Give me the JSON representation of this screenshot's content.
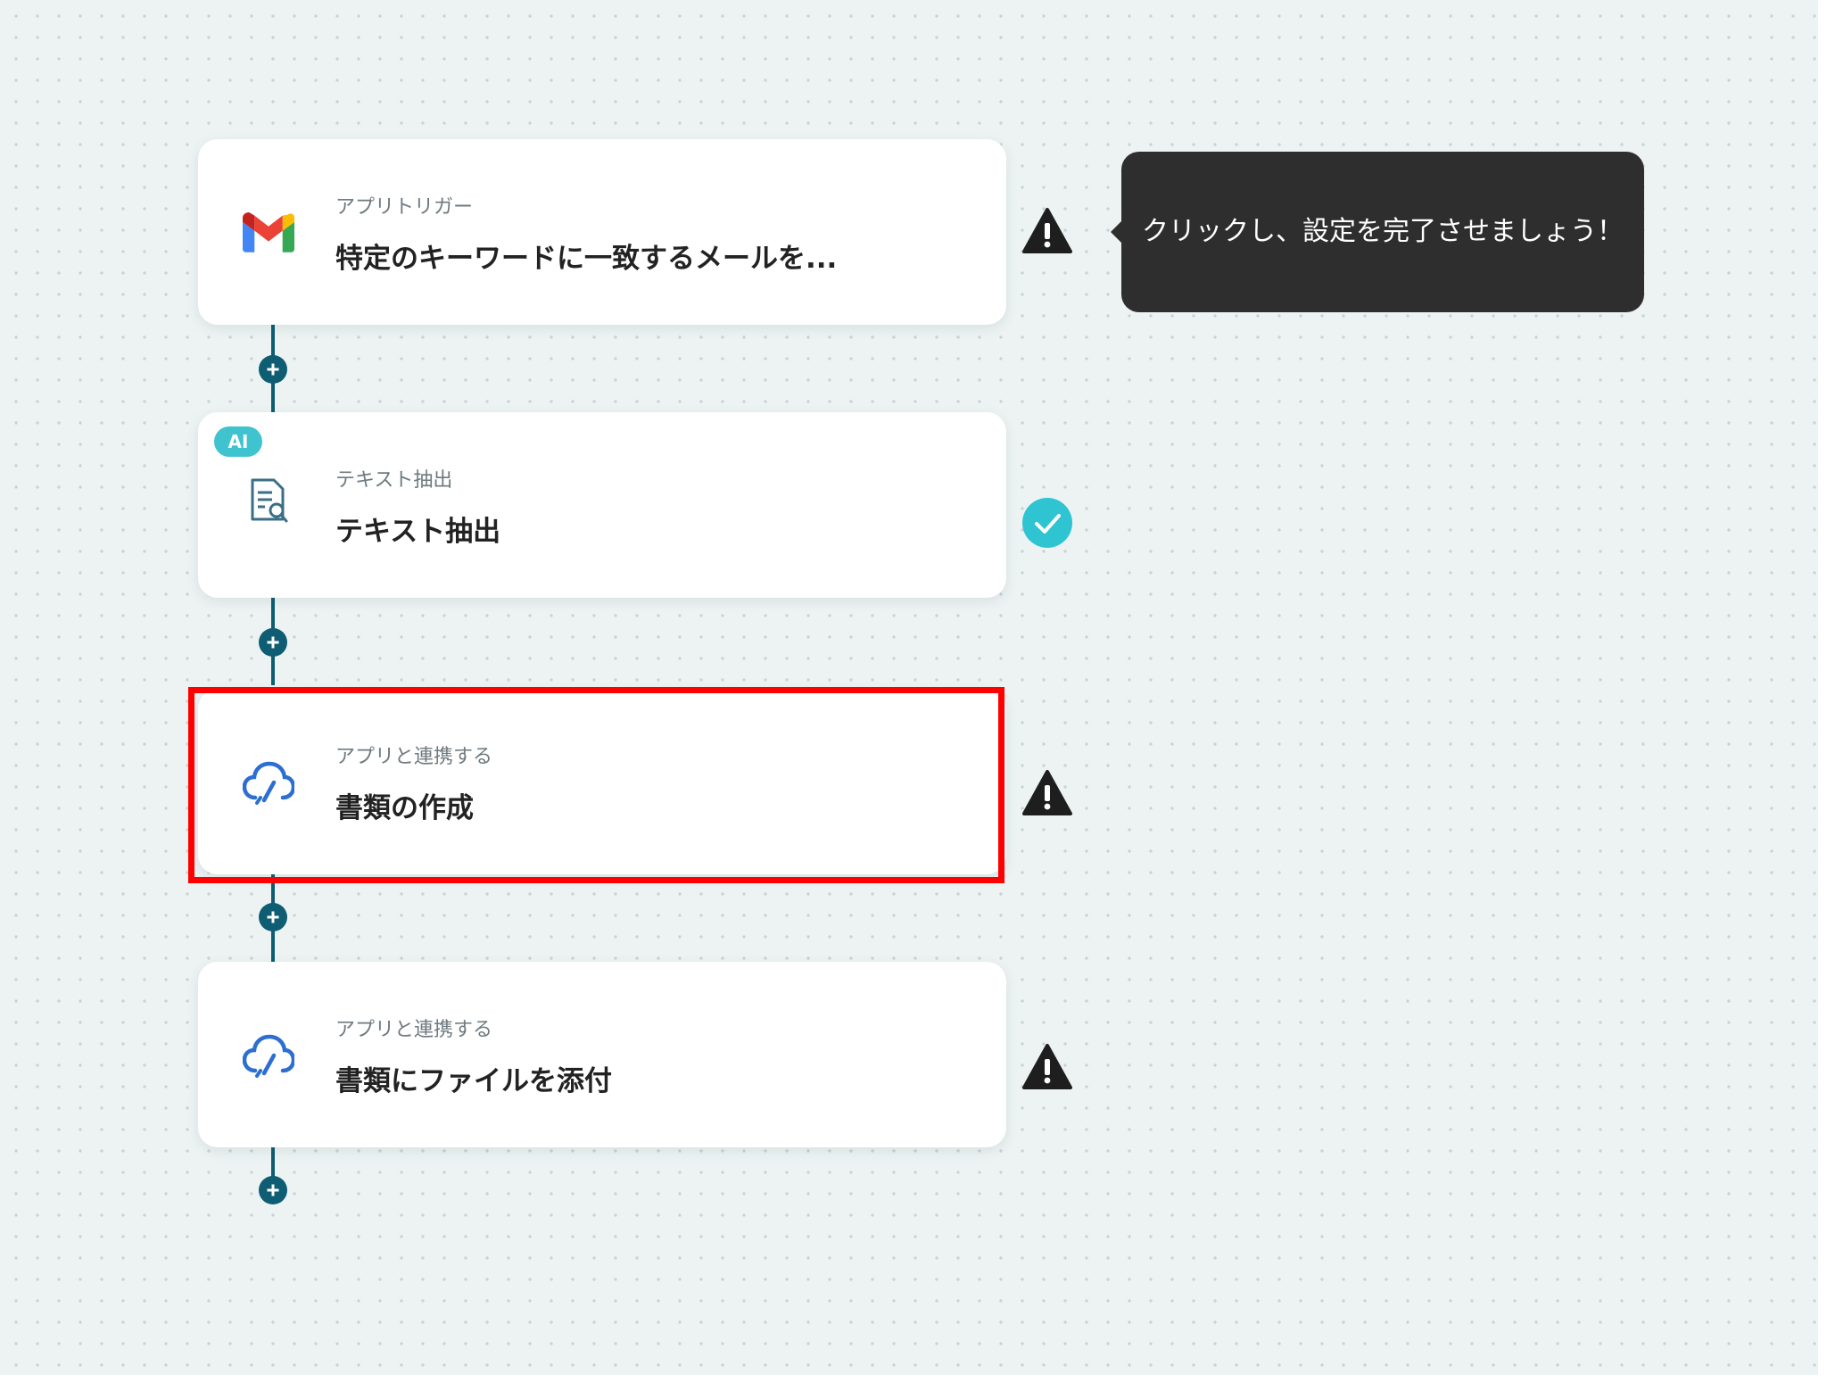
{
  "steps": [
    {
      "type_label": "アプリトリガー",
      "title": "特定のキーワードに一致するメールを...",
      "icon": "gmail-icon",
      "status": "warning"
    },
    {
      "badge": "AI",
      "type_label": "テキスト抽出",
      "title": "テキスト抽出",
      "icon": "document-search-icon",
      "status": "complete"
    },
    {
      "type_label": "アプリと連携する",
      "title": "書類の作成",
      "icon": "cloud-sign-icon",
      "status": "warning",
      "highlighted": true
    },
    {
      "type_label": "アプリと連携する",
      "title": "書類にファイルを添付",
      "icon": "cloud-sign-icon",
      "status": "warning"
    }
  ],
  "tooltip": {
    "text": "クリックし、設定を完了させましょう！"
  },
  "colors": {
    "connector": "#0e5d73",
    "highlight": "#ff0000",
    "complete": "#2fc4d1",
    "warning": "#1e1e1e",
    "tooltip_bg": "#2e2e2e"
  }
}
